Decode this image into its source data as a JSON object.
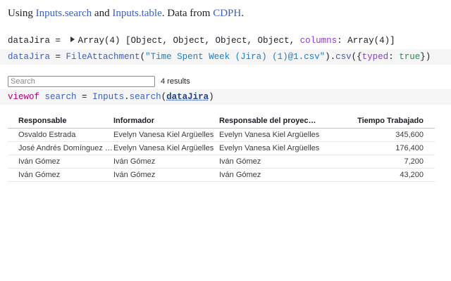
{
  "intro": {
    "prefix": "Using ",
    "link1": "Inputs.search",
    "mid": " and ",
    "link2": "Inputs.table",
    "mid2": ". Data from ",
    "link3": "CDPH",
    "suffix": "."
  },
  "output_cell": {
    "name": "dataJira = ",
    "value_a": "Array(4) [Object, Object, Object, Object, ",
    "prop": "columns",
    "value_b": ": Array(4)]"
  },
  "code1": {
    "p1": "dataJira",
    "p2": " = ",
    "p3": "FileAttachment",
    "p4": "(",
    "p5": "\"Time Spent Week (Jira) (1)@1.csv\"",
    "p6": ").",
    "p7": "csv",
    "p8": "({",
    "p9": "typed",
    "p10": ": ",
    "p11": "true",
    "p12": "})"
  },
  "search": {
    "placeholder": "Search",
    "value": "",
    "results": "4 results"
  },
  "code2": {
    "p1": "viewof",
    "p2": " ",
    "p3": "search",
    "p4": " = ",
    "p5": "Inputs",
    "p6": ".",
    "p7": "search",
    "p8": "(",
    "p9": "dataJira",
    "p10": ")"
  },
  "table": {
    "headers": [
      "Responsable",
      "Informador",
      "Responsable del proyec…",
      "Tiempo Trabajado"
    ],
    "rows": [
      [
        "Osvaldo Estrada",
        "Evelyn Vanesa Kiel Argüelles",
        "Evelyn Vanesa Kiel Argüelles",
        "345,600"
      ],
      [
        "José Andrés Domínguez …",
        "Evelyn Vanesa Kiel Argüelles",
        "Evelyn Vanesa Kiel Argüelles",
        "176,400"
      ],
      [
        "Iván Gómez",
        "Iván Gómez",
        "Iván Gómez",
        "7,200"
      ],
      [
        "Iván Gómez",
        "Iván Gómez",
        "Iván Gómez",
        "43,200"
      ]
    ]
  },
  "colors": {
    "link": "#3b5fc0",
    "string": "#1f7ebf",
    "keyword": "#b3007a",
    "property": "#8a3fc8",
    "boolean": "#2b8c4a",
    "code_bg": "#f5f5f5"
  }
}
